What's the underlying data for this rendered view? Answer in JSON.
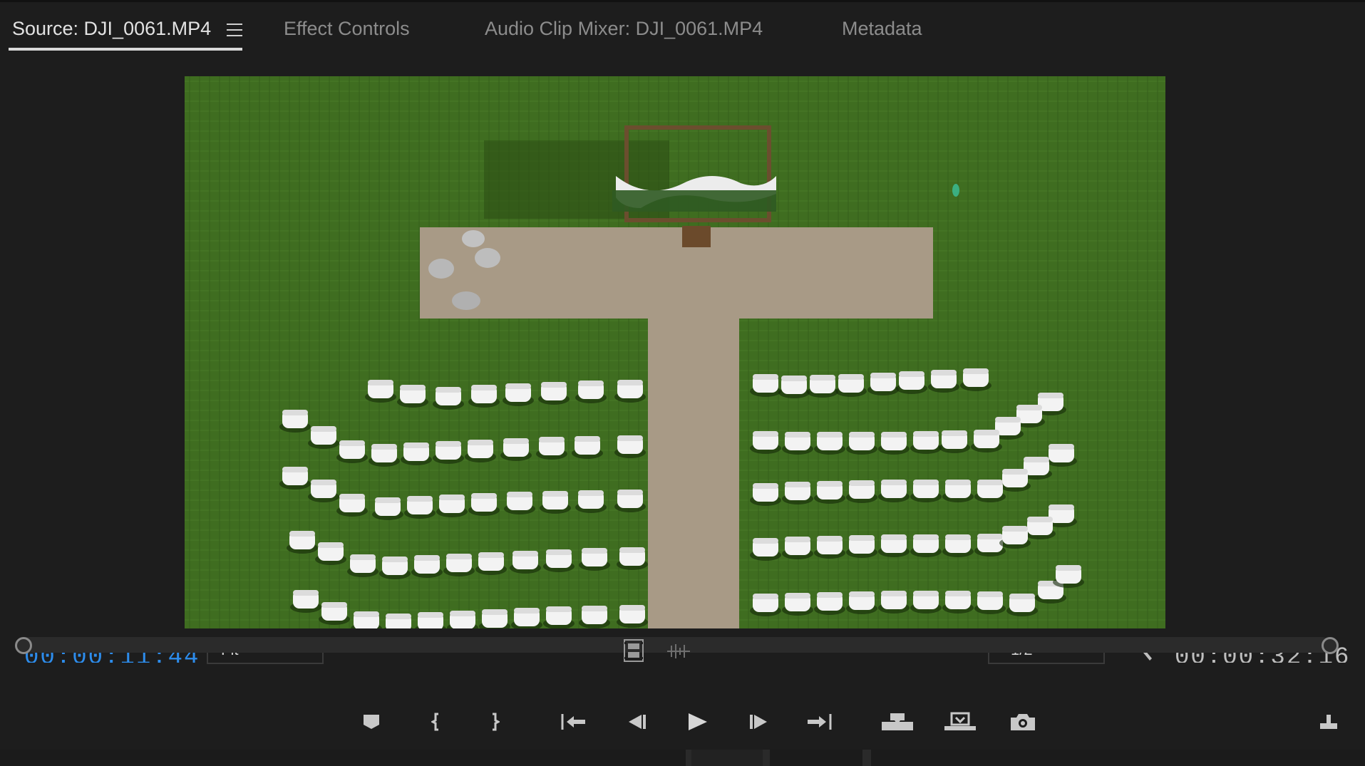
{
  "tabs": [
    {
      "label": "Source: DJI_0061.MP4",
      "active": true
    },
    {
      "label": "Effect Controls",
      "active": false
    },
    {
      "label": "Audio Clip Mixer: DJI_0061.MP4",
      "active": false
    },
    {
      "label": "Metadata",
      "active": false
    }
  ],
  "timecode": {
    "current": "00:00:11:44",
    "duration": "00:00:32:16"
  },
  "zoom": {
    "selected": "Fit"
  },
  "resolution": {
    "selected": "1/2"
  },
  "colors": {
    "accent_timecode": "#2d8ceb",
    "panel_bg": "#1d1d1d",
    "grass": "#3c6a1e",
    "walkway": "#a89a86"
  },
  "icons": {
    "tab_menu": "hamburger-icon",
    "drag_video": "film-strip-icon",
    "drag_audio": "waveform-icon",
    "settings": "wrench-icon",
    "transport": [
      "add-marker-icon",
      "mark-in-icon",
      "mark-out-icon",
      "go-to-in-icon",
      "step-back-icon",
      "play-icon",
      "step-forward-icon",
      "go-to-out-icon",
      "insert-icon",
      "overwrite-icon",
      "export-frame-icon",
      "button-editor-icon"
    ]
  }
}
